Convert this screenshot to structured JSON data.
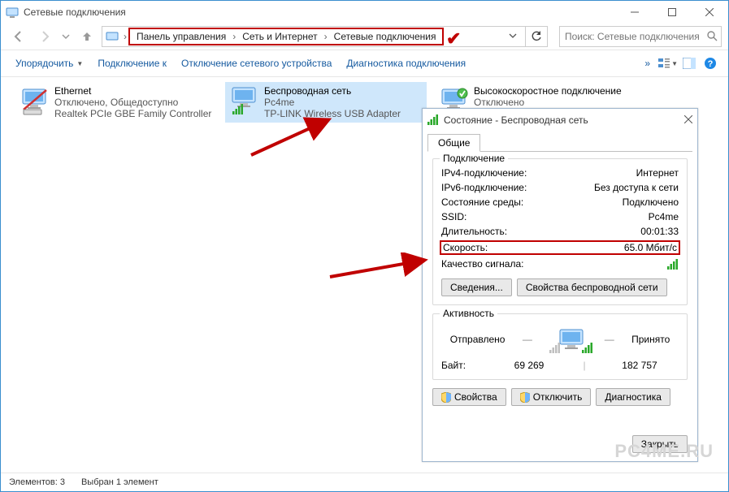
{
  "window": {
    "title": "Сетевые подключения"
  },
  "breadcrumb": {
    "items": [
      "Панель управления",
      "Сеть и Интернет",
      "Сетевые подключения"
    ]
  },
  "search": {
    "placeholder": "Поиск: Сетевые подключения"
  },
  "toolbar": {
    "organize": "Упорядочить",
    "connect": "Подключение к",
    "disable": "Отключение сетевого устройства",
    "diagnose": "Диагностика подключения"
  },
  "connections": [
    {
      "title": "Ethernet",
      "line2": "Отключено, Общедоступно",
      "line3": "Realtek PCIe GBE Family Controller"
    },
    {
      "title": "Беспроводная сеть",
      "line2": "Pc4me",
      "line3": "TP-LINK Wireless USB Adapter"
    },
    {
      "title": "Высокоскоростное подключение",
      "line2": "Отключено",
      "line3": ""
    }
  ],
  "dialog": {
    "title": "Состояние - Беспроводная сеть",
    "tab": "Общие",
    "group_conn": "Подключение",
    "group_act": "Активность",
    "rows": {
      "ipv4_k": "IPv4-подключение:",
      "ipv4_v": "Интернет",
      "ipv6_k": "IPv6-подключение:",
      "ipv6_v": "Без доступа к сети",
      "media_k": "Состояние среды:",
      "media_v": "Подключено",
      "ssid_k": "SSID:",
      "ssid_v": "Pc4me",
      "dur_k": "Длительность:",
      "dur_v": "00:01:33",
      "speed_k": "Скорость:",
      "speed_v": "65.0 Мбит/с",
      "signal_k": "Качество сигнала:"
    },
    "btn_details": "Сведения...",
    "btn_wprops": "Свойства беспроводной сети",
    "act_sent": "Отправлено",
    "act_sep": "—",
    "act_recv": "Принято",
    "bytes_label": "Байт:",
    "bytes_sent": "69 269",
    "bytes_recv": "182 757",
    "btn_props": "Свойства",
    "btn_disable": "Отключить",
    "btn_diag": "Диагностика",
    "btn_close": "Закрыть"
  },
  "status": {
    "elements_label": "Элементов:",
    "elements_val": "3",
    "selected": "Выбран 1 элемент"
  },
  "watermark": "PC4ME.RU"
}
